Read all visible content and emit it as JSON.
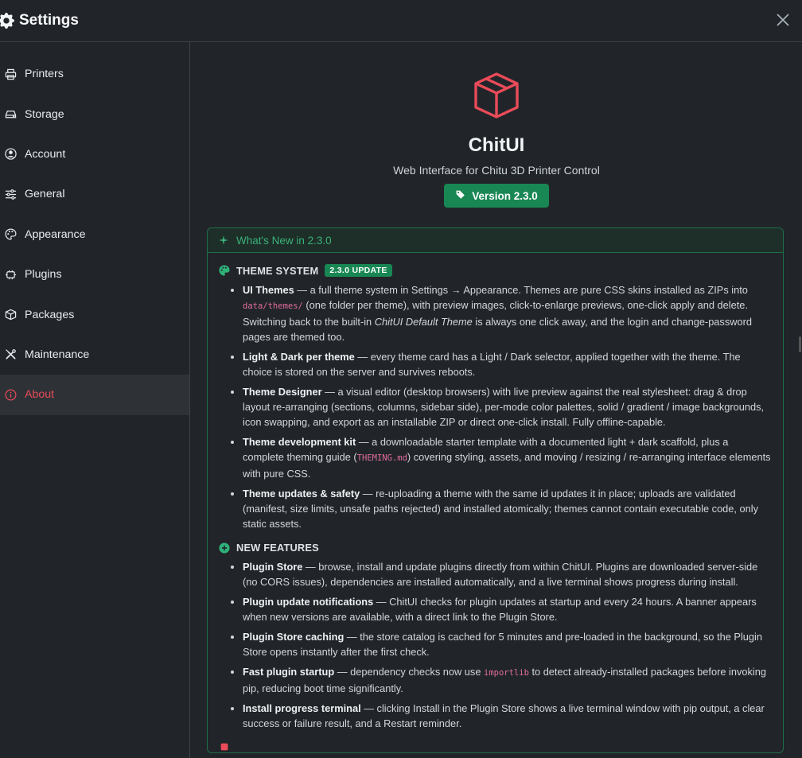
{
  "header": {
    "title": "Settings"
  },
  "sidebar": {
    "items": [
      {
        "label": "Printers",
        "icon": "printer-icon"
      },
      {
        "label": "Storage",
        "icon": "hdd-icon"
      },
      {
        "label": "Account",
        "icon": "person-circle-icon"
      },
      {
        "label": "General",
        "icon": "sliders-icon"
      },
      {
        "label": "Appearance",
        "icon": "palette-icon"
      },
      {
        "label": "Plugins",
        "icon": "plugin-icon"
      },
      {
        "label": "Packages",
        "icon": "box-icon"
      },
      {
        "label": "Maintenance",
        "icon": "tools-icon"
      },
      {
        "label": "About",
        "icon": "info-circle-icon",
        "active": true
      }
    ]
  },
  "about": {
    "app_name": "ChitUI",
    "subtitle": "Web Interface for Chitu 3D Printer Control",
    "version_label": "Version 2.3.0"
  },
  "whats_new": {
    "title": "What's New in 2.3.0",
    "theme_section": {
      "title": "THEME SYSTEM",
      "badge": "2.3.0 UPDATE",
      "items": [
        {
          "b": "UI Themes",
          "t1": " — a full theme system in Settings → Appearance. Themes are pure CSS skins installed as ZIPs into ",
          "code": "data/themes/",
          "t2": " (one folder per theme), with preview images, click-to-enlarge previews, one-click apply and delete. Switching back to the built-in ",
          "em": "ChitUI Default Theme",
          "t3": " is always one click away, and the login and change-password pages are themed too."
        },
        {
          "b": "Light & Dark per theme",
          "t1": " — every theme card has a Light / Dark selector, applied together with the theme. The choice is stored on the server and survives reboots."
        },
        {
          "b": "Theme Designer",
          "t1": " — a visual editor (desktop browsers) with live preview against the real stylesheet: drag & drop layout re-arranging (sections, columns, sidebar side), per-mode color palettes, solid / gradient / image backgrounds, icon swapping, and export as an installable ZIP or direct one-click install. Fully offline-capable."
        },
        {
          "b": "Theme development kit",
          "t1": " — a downloadable starter template with a documented light + dark scaffold, plus a complete theming guide (",
          "code": "THEMING.md",
          "t2": ") covering styling, assets, and moving / resizing / re-arranging interface elements with pure CSS."
        },
        {
          "b": "Theme updates & safety",
          "t1": " — re-uploading a theme with the same id updates it in place; uploads are validated (manifest, size limits, unsafe paths rejected) and installed atomically; themes cannot contain executable code, only static assets."
        }
      ]
    },
    "features_section": {
      "title": "NEW FEATURES",
      "items": [
        {
          "b": "Plugin Store",
          "t1": " — browse, install and update plugins directly from within ChitUI. Plugins are downloaded server-side (no CORS issues), dependencies are installed automatically, and a live terminal shows progress during install."
        },
        {
          "b": "Plugin update notifications",
          "t1": " — ChitUI checks for plugin updates at startup and every 24 hours. A banner appears when new versions are available, with a direct link to the Plugin Store."
        },
        {
          "b": "Plugin Store caching",
          "t1": " — the store catalog is cached for 5 minutes and pre-loaded in the background, so the Plugin Store opens instantly after the first check."
        },
        {
          "b": "Fast plugin startup",
          "t1": " — dependency checks now use ",
          "code": "importlib",
          "t2": " to detect already-installed packages before invoking pip, reducing boot time significantly."
        },
        {
          "b": "Install progress terminal",
          "t1": " — clicking Install in the Plugin Store shows a live terminal window with pip output, a clear success or failure result, and a Restart reminder."
        }
      ]
    }
  }
}
